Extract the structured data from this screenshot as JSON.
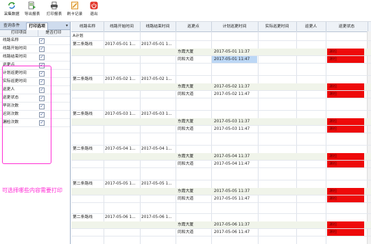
{
  "toolbar": {
    "buttons": [
      {
        "label": "采集数据",
        "icon": "refresh-icon",
        "color": "#3a9a3a"
      },
      {
        "label": "导出报表",
        "icon": "export-icon",
        "color": "#4c8c2e"
      },
      {
        "label": "打印报表",
        "icon": "printer-icon",
        "color": "#444444"
      },
      {
        "label": "刷卡记录",
        "icon": "card-record-icon",
        "color": "#d78a1a"
      },
      {
        "label": "退出",
        "icon": "power-icon",
        "color": "#e2352a"
      }
    ]
  },
  "left_panel": {
    "tabs": [
      "查询条件",
      "打印选项"
    ],
    "active_tab": "打印选项",
    "pin_glyph": "▾",
    "columns": [
      "打印项目",
      "是否打印"
    ],
    "items": [
      {
        "label": "线路名称",
        "checked": true
      },
      {
        "label": "线路开始时间",
        "checked": true
      },
      {
        "label": "线路结束时间",
        "checked": true
      },
      {
        "label": "巡更点",
        "checked": true
      },
      {
        "label": "计划巡更时间",
        "checked": true
      },
      {
        "label": "实际巡更时间",
        "checked": true
      },
      {
        "label": "巡更人",
        "checked": true
      },
      {
        "label": "巡更状态",
        "checked": true
      },
      {
        "label": "早到次数",
        "checked": true
      },
      {
        "label": "迟到次数",
        "checked": true
      },
      {
        "label": "漏检次数",
        "checked": true
      }
    ],
    "annotation": "可选择哪些内容需要打印"
  },
  "grid": {
    "columns": [
      "线路名称",
      "线路开始时间",
      "线路结束时间",
      "巡更点",
      "计划巡更时间",
      "实际巡更时间",
      "巡更人",
      "巡更状态"
    ],
    "plan_label": "A计划",
    "groups": [
      {
        "route": "第二条路线",
        "start": "2017-05-01 1...",
        "end": "2017-05-01 1...",
        "rows": [
          {
            "point": "东霞大厦",
            "planned": "2017-05-01 11:37",
            "status": "漏检"
          },
          {
            "point": "同和大道",
            "planned": "2017-05-01 11:47",
            "status": "漏检"
          }
        ]
      },
      {
        "route": "第二条路线",
        "start": "2017-05-02 1...",
        "end": "2017-05-02 1...",
        "rows": [
          {
            "point": "东霞大厦",
            "planned": "2017-05-02 11:37",
            "status": "漏检"
          },
          {
            "point": "同和大道",
            "planned": "2017-05-02 11:47",
            "status": "漏检"
          }
        ]
      },
      {
        "route": "第二条路线",
        "start": "2017-05-03 1...",
        "end": "2017-05-03 1...",
        "rows": [
          {
            "point": "东霞大厦",
            "planned": "2017-05-03 11:37",
            "status": "漏检"
          },
          {
            "point": "同和大道",
            "planned": "2017-05-03 11:47",
            "status": "漏检"
          }
        ]
      },
      {
        "route": "第二条路线",
        "start": "2017-05-04 1...",
        "end": "2017-05-04 1...",
        "rows": [
          {
            "point": "东霞大厦",
            "planned": "2017-05-04 11:37",
            "status": "漏检"
          },
          {
            "point": "同和大道",
            "planned": "2017-05-04 11:47",
            "status": "漏检"
          }
        ]
      },
      {
        "route": "第二条路线",
        "start": "2017-05-05 1...",
        "end": "2017-05-05 1...",
        "rows": [
          {
            "point": "东霞大厦",
            "planned": "2017-05-05 11:37",
            "status": "漏检"
          },
          {
            "point": "同和大道",
            "planned": "2017-05-05 11:47",
            "status": "漏检"
          }
        ]
      },
      {
        "route": "第二条路线",
        "start": "2017-05-06 1...",
        "end": "2017-05-06 1...",
        "rows": [
          {
            "point": "东霞大厦",
            "planned": "2017-05-06 11:37",
            "status": "漏检"
          },
          {
            "point": "同和大道",
            "planned": "2017-05-06 11:47",
            "status": "漏检"
          }
        ]
      }
    ],
    "status_color": "#ee0a0a"
  }
}
